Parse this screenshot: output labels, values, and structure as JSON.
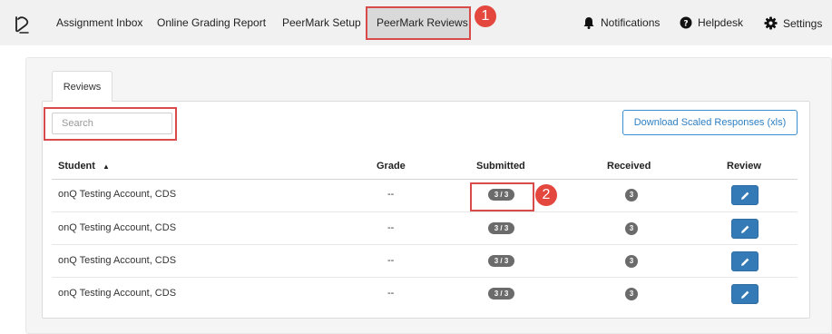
{
  "nav": {
    "items": [
      "Assignment Inbox",
      "Online Grading Report",
      "PeerMark Setup",
      "PeerMark Reviews"
    ],
    "notifications": "Notifications",
    "helpdesk": "Helpdesk",
    "settings": "Settings"
  },
  "markers": [
    "1",
    "2"
  ],
  "tabs": {
    "reviews": "Reviews"
  },
  "search": {
    "placeholder": "Search",
    "value": ""
  },
  "download_label": "Download Scaled Responses (xls)",
  "table": {
    "headers": {
      "student": "Student",
      "grade": "Grade",
      "submitted": "Submitted",
      "received": "Received",
      "review": "Review"
    },
    "sort_indicator": "▲",
    "rows": [
      {
        "student": "onQ Testing Account, CDS",
        "grade": "--",
        "submitted": "3 / 3",
        "received": "3"
      },
      {
        "student": "onQ Testing Account, CDS",
        "grade": "--",
        "submitted": "3 / 3",
        "received": "3"
      },
      {
        "student": "onQ Testing Account, CDS",
        "grade": "--",
        "submitted": "3 / 3",
        "received": "3"
      },
      {
        "student": "onQ Testing Account, CDS",
        "grade": "--",
        "submitted": "3 / 3",
        "received": "3"
      }
    ]
  },
  "colors": {
    "highlight": "#d94a4a",
    "marker": "#e3473d",
    "primary": "#337ab7",
    "badge": "#6b6b6b"
  },
  "icons": [
    "turnitin-logo-icon",
    "bell-icon",
    "question-circle-icon",
    "gear-icon",
    "pencil-icon"
  ]
}
